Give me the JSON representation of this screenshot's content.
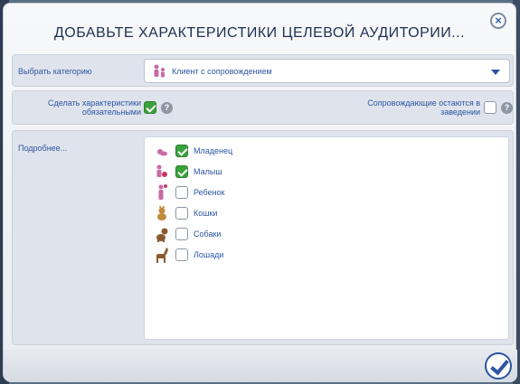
{
  "dialog": {
    "title": "ДОБАВЬТЕ ХАРАКТЕРИСТИКИ ЦЕЛЕВОЙ АУДИТОРИИ...",
    "close_icon": "close-icon",
    "confirm_icon": "checkmark-icon"
  },
  "category": {
    "label": "Выбрать категорию",
    "selected": "Клиент с сопровождением",
    "icon": "escort-client-icon"
  },
  "options": {
    "required_label": "Сделать характеристики обязательными",
    "required_checked": true,
    "companions_label": "Сопровождающие остаются в заведении",
    "companions_checked": false,
    "help_glyph": "?"
  },
  "details": {
    "label": "Подробнее...",
    "items": [
      {
        "label": "Младенец",
        "checked": true,
        "icon": "infant-icon"
      },
      {
        "label": "Малыш",
        "checked": true,
        "icon": "toddler-icon"
      },
      {
        "label": "Ребенок",
        "checked": false,
        "icon": "child-icon"
      },
      {
        "label": "Кошки",
        "checked": false,
        "icon": "cat-icon"
      },
      {
        "label": "Собаки",
        "checked": false,
        "icon": "dog-icon"
      },
      {
        "label": "Лошади",
        "checked": false,
        "icon": "horse-icon"
      }
    ]
  },
  "colors": {
    "accent": "#2c55a3",
    "checkbox_on": "#3aa23a",
    "icon_pink": "#c86aa6",
    "icon_brown": "#8a5a2e"
  }
}
